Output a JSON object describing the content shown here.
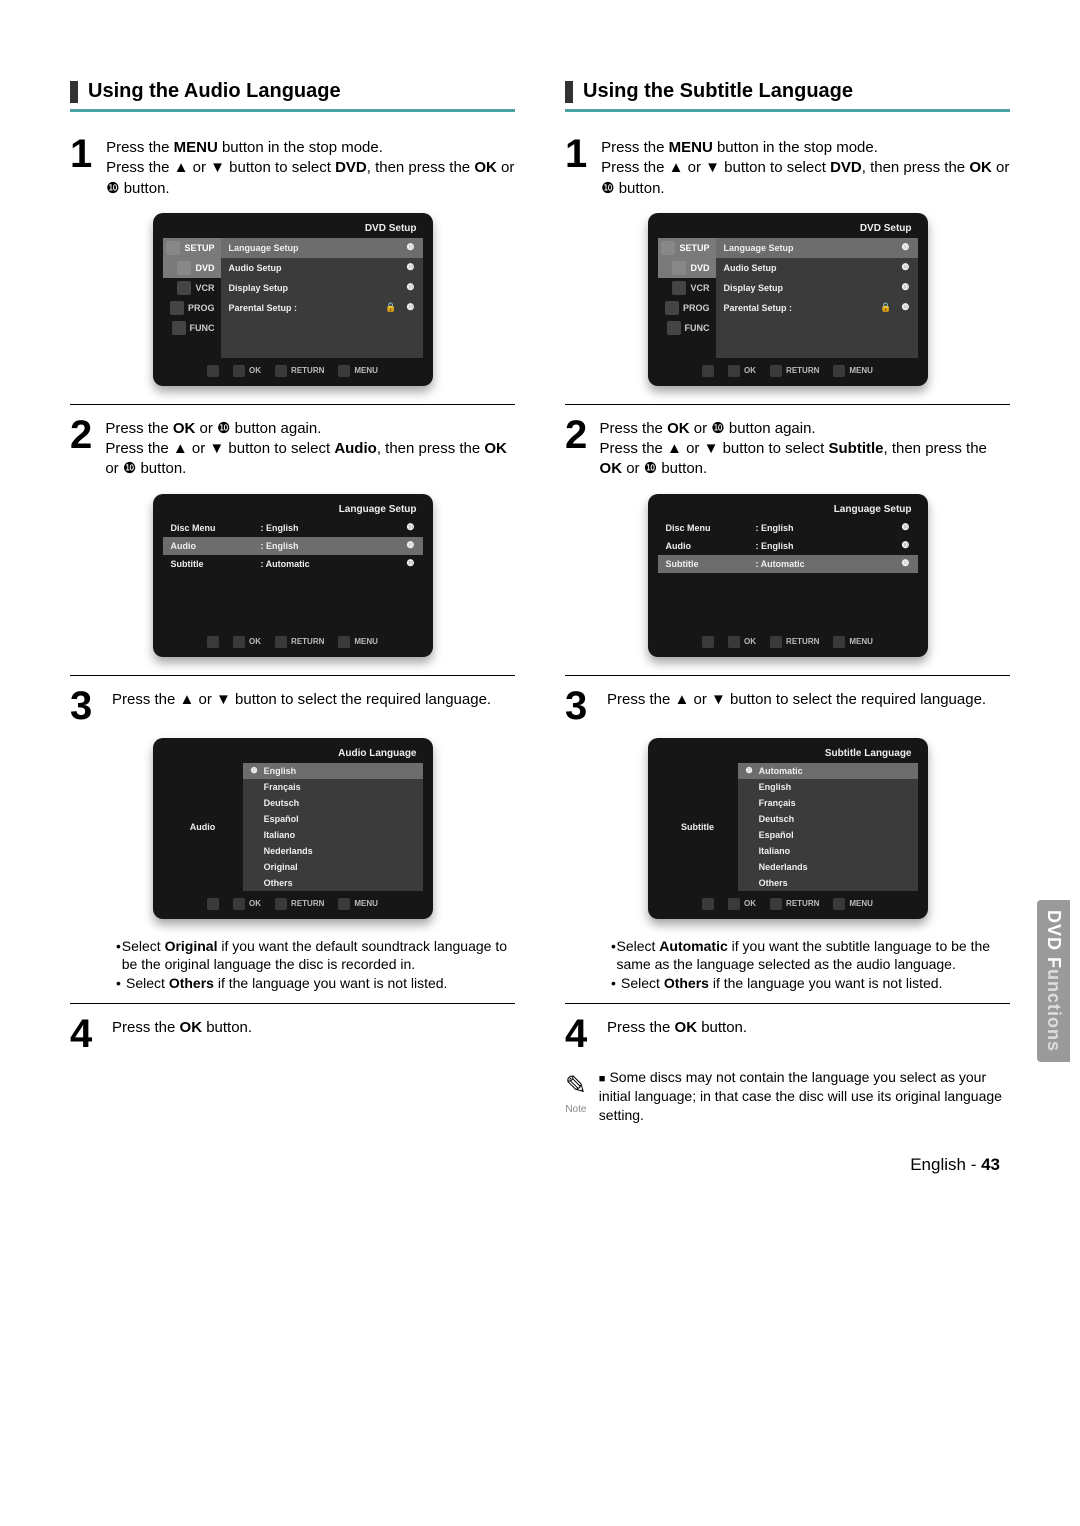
{
  "sideTab": {
    "bold": "DVD F",
    "dim": "unctions"
  },
  "footer": {
    "language": "English",
    "sep": " - ",
    "page": "43"
  },
  "glyphs": {
    "up": "▲",
    "down": "▼",
    "right": "❿",
    "chev": "❿",
    "bullet": "•",
    "square": "■",
    "lock": "🔒",
    "note": "✎"
  },
  "shared": {
    "step1_lines": [
      "Press the <b>MENU</b> button in the stop mode.",
      "Press the ▲ or ▼ button to select <b>DVD</b>, then press the <b>OK</b> or ❿ button."
    ],
    "step4": "Press the <b>OK</b> button.",
    "osdSetupTitle": "DVD  Setup",
    "osdLangTitle": "Language Setup",
    "osdFooter": {
      "ok": "OK",
      "return": "RETURN",
      "menu": "MENU"
    },
    "sideTabs": [
      "SETUP",
      "DVD",
      "VCR",
      "PROG",
      "FUNC"
    ],
    "mainMenu": [
      "Language Setup",
      "Audio Setup",
      "Display Setup",
      "Parental Setup :"
    ]
  },
  "left": {
    "title": "Using the Audio Language",
    "step2_lines": [
      "Press the <b>OK</b> or ❿ button again.",
      "Press the ▲ or ▼ button to select <b>Audio</b>, then press the <b>OK</b> or ❿ button."
    ],
    "step3": "Press the ▲ or ▼ button to select the required language.",
    "osd2": {
      "rows": [
        {
          "label": "Disc Menu",
          "value": ": English",
          "sel": false
        },
        {
          "label": "Audio",
          "value": ": English",
          "sel": true
        },
        {
          "label": "Subtitle",
          "value": ": Automatic",
          "sel": false
        }
      ]
    },
    "osd3": {
      "title": "Audio Language",
      "leftLabel": "Audio",
      "selected": "English",
      "options": [
        "English",
        "Français",
        "Deutsch",
        "Español",
        "Italiano",
        "Nederlands",
        "Original",
        "Others"
      ]
    },
    "bullets": [
      "Select <b>Original</b> if you want the default soundtrack language to be the original language the disc is recorded in.",
      "Select <b>Others</b> if the language you want is not listed."
    ]
  },
  "right": {
    "title": "Using the Subtitle Language",
    "step2_lines": [
      "Press the <b>OK</b> or ❿ button again.",
      "Press the ▲ or ▼ button to select <b>Subtitle</b>, then press the <b>OK</b> or ❿ button."
    ],
    "step3": "Press the ▲ or ▼ button to select the required language.",
    "osd2": {
      "rows": [
        {
          "label": "Disc Menu",
          "value": ": English",
          "sel": false
        },
        {
          "label": "Audio",
          "value": ": English",
          "sel": false
        },
        {
          "label": "Subtitle",
          "value": ": Automatic",
          "sel": true
        }
      ]
    },
    "osd3": {
      "title": "Subtitle Language",
      "leftLabel": "Subtitle",
      "selected": "Automatic",
      "options": [
        "Automatic",
        "English",
        "Français",
        "Deutsch",
        "Español",
        "Italiano",
        "Nederlands",
        "Others"
      ]
    },
    "bullets": [
      "Select <b>Automatic</b> if you want the subtitle language to be the same as the language selected as the audio language.",
      "Select <b>Others</b> if the language you want is not listed."
    ],
    "note": "Some discs may not contain the language you select as your initial language; in that case the disc will use its original language setting.",
    "noteLabel": "Note"
  }
}
